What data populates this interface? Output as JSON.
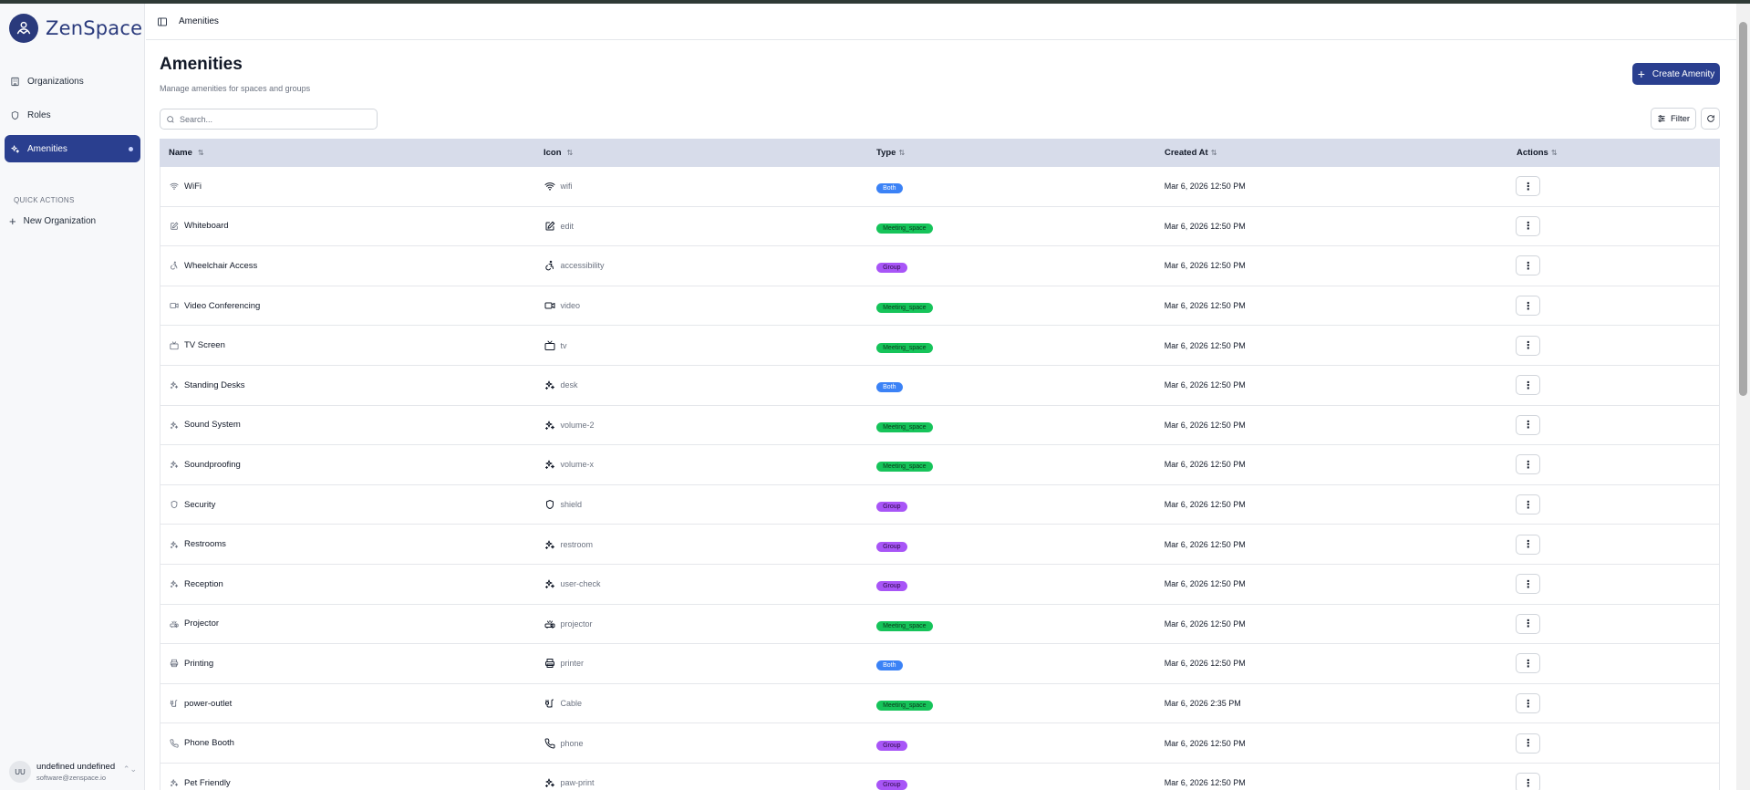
{
  "app": {
    "brand": "ZenSpace"
  },
  "sidebar": {
    "items": [
      {
        "label": "Organizations",
        "icon": "building-icon",
        "active": false
      },
      {
        "label": "Roles",
        "icon": "shield-icon",
        "active": false
      },
      {
        "label": "Amenities",
        "icon": "sparkles-icon",
        "active": true
      }
    ],
    "quick_actions_title": "QUICK ACTIONS",
    "quick_actions": [
      {
        "label": "New Organization",
        "icon": "plus-icon"
      }
    ],
    "user": {
      "initials": "UU",
      "name": "undefined undefined",
      "email": "software@zenspace.io"
    }
  },
  "header": {
    "breadcrumb": "Amenities"
  },
  "page": {
    "title": "Amenities",
    "subtitle": "Manage amenities for spaces and groups",
    "create_label": "Create Amenity",
    "search_placeholder": "Search...",
    "filter_label": "Filter"
  },
  "table": {
    "columns": [
      "Name",
      "Icon",
      "Type",
      "Created At",
      "Actions"
    ],
    "rows": [
      {
        "name": "WiFi",
        "icon": "wifi",
        "type": "Both",
        "created": "Mar 6, 2026 12:50 PM"
      },
      {
        "name": "Whiteboard",
        "icon": "edit",
        "type": "Meeting_space",
        "created": "Mar 6, 2026 12:50 PM"
      },
      {
        "name": "Wheelchair Access",
        "icon": "accessibility",
        "type": "Group",
        "created": "Mar 6, 2026 12:50 PM"
      },
      {
        "name": "Video Conferencing",
        "icon": "video",
        "type": "Meeting_space",
        "created": "Mar 6, 2026 12:50 PM"
      },
      {
        "name": "TV Screen",
        "icon": "tv",
        "type": "Meeting_space",
        "created": "Mar 6, 2026 12:50 PM"
      },
      {
        "name": "Standing Desks",
        "icon": "desk",
        "type": "Both",
        "created": "Mar 6, 2026 12:50 PM"
      },
      {
        "name": "Sound System",
        "icon": "volume-2",
        "type": "Meeting_space",
        "created": "Mar 6, 2026 12:50 PM"
      },
      {
        "name": "Soundproofing",
        "icon": "volume-x",
        "type": "Meeting_space",
        "created": "Mar 6, 2026 12:50 PM"
      },
      {
        "name": "Security",
        "icon": "shield",
        "type": "Group",
        "created": "Mar 6, 2026 12:50 PM"
      },
      {
        "name": "Restrooms",
        "icon": "restroom",
        "type": "Group",
        "created": "Mar 6, 2026 12:50 PM"
      },
      {
        "name": "Reception",
        "icon": "user-check",
        "type": "Group",
        "created": "Mar 6, 2026 12:50 PM"
      },
      {
        "name": "Projector",
        "icon": "projector",
        "type": "Meeting_space",
        "created": "Mar 6, 2026 12:50 PM"
      },
      {
        "name": "Printing",
        "icon": "printer",
        "type": "Both",
        "created": "Mar 6, 2026 12:50 PM"
      },
      {
        "name": "power-outlet",
        "icon": "Cable",
        "type": "Meeting_space",
        "created": "Mar 6, 2026 2:35 PM"
      },
      {
        "name": "Phone Booth",
        "icon": "phone",
        "type": "Group",
        "created": "Mar 6, 2026 12:50 PM"
      },
      {
        "name": "Pet Friendly",
        "icon": "paw-print",
        "type": "Group",
        "created": "Mar 6, 2026 12:50 PM"
      }
    ]
  },
  "colors": {
    "primary": "#2a3f8f",
    "both": "#3b82f6",
    "meeting_space": "#16c45a",
    "group": "#a855f7",
    "table_header": "#d7dcea"
  }
}
